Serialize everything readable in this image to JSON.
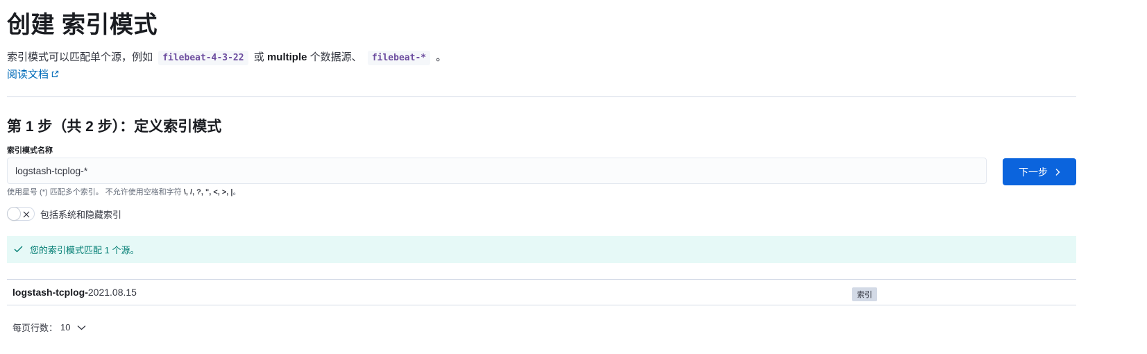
{
  "page": {
    "title": "创建 索引模式"
  },
  "description": {
    "part1": "索引模式可以匹配单个源，例如",
    "example1": "filebeat-4-3-22",
    "part2": "或",
    "multiple": "multiple",
    "part3": "个数据源、",
    "example2": "filebeat-*",
    "part4": "。",
    "doc_link": "阅读文档"
  },
  "step": {
    "title": "第 1 步（共 2 步）：定义索引模式",
    "field_label": "索引模式名称",
    "input_value": "logstash-tcplog-*",
    "next_label": "下一步",
    "help_prefix": "使用星号 (*) 匹配多个索引。 不允许使用空格和字符",
    "help_chars": "\\, /, ?, \", <, >, |",
    "help_suffix": "。"
  },
  "toggle": {
    "label": "包括系统和隐藏索引",
    "checked": false
  },
  "callout": {
    "text": "您的索引模式匹配 1 个源。",
    "color": "#017d73"
  },
  "results": [
    {
      "name_match": "logstash-tcplog-",
      "name_rest": "2021.08.15",
      "badge": "索引"
    }
  ],
  "pagination": {
    "label": "每页行数：",
    "value": "10"
  },
  "colors": {
    "primary": "#0b64dd",
    "link": "#006bb8",
    "success_bg": "#e6f9f7"
  }
}
